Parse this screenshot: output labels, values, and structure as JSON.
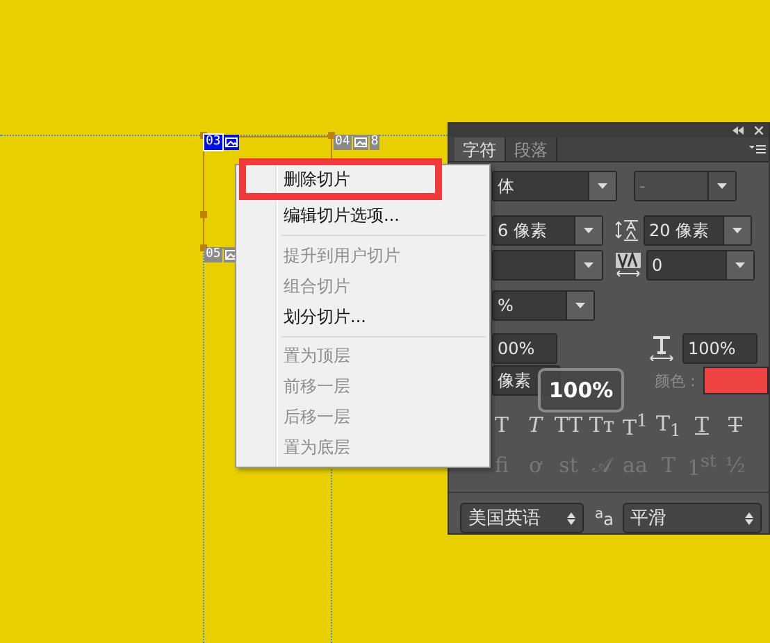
{
  "canvas": {
    "slices": [
      {
        "number": "03",
        "kind": "user",
        "selected": true
      },
      {
        "number": "04",
        "kind": "auto",
        "selected": false,
        "link": "8"
      },
      {
        "number": "05",
        "kind": "auto",
        "selected": false
      }
    ]
  },
  "character_panel": {
    "tabs": [
      {
        "label": "字符",
        "selected": true
      },
      {
        "label": "段落",
        "selected": false
      }
    ],
    "font_family": "体",
    "font_style": "-",
    "font_size": "6 像素",
    "leading": "20 像素",
    "tracking": "0",
    "scale": "%",
    "vertical_scale": "00%",
    "horizontal_scale": "100%",
    "baseline_shift": "像素",
    "color_label": "颜色：",
    "tooltip": "100%",
    "style_buttons": [
      {
        "label": "T",
        "kind": "plain"
      },
      {
        "label": "T",
        "kind": "italic"
      },
      {
        "label": "TT",
        "kind": "plain"
      },
      {
        "label": "Tт",
        "kind": "plain"
      },
      {
        "label": "T$^{1}$",
        "kind": "plain"
      },
      {
        "label": "T$_{1}$",
        "kind": "plain"
      },
      {
        "label": "T",
        "kind": "underline"
      },
      {
        "label": "T",
        "kind": "strike"
      }
    ],
    "opentype_buttons": [
      {
        "label": "fi"
      },
      {
        "label": "ơ"
      },
      {
        "label": "st"
      },
      {
        "label": "𝒜"
      },
      {
        "label": "aa"
      },
      {
        "label": "T"
      },
      {
        "label": "1$^{st}$"
      },
      {
        "label": "½"
      }
    ],
    "language": "美国英语",
    "antialias_label": "$^{a}$a",
    "antialias": "平滑"
  },
  "context_menu": {
    "items": [
      {
        "kind": "item",
        "label": "删除切片",
        "disabled": false,
        "marked": true
      },
      {
        "kind": "item",
        "label": "编辑切片选项...",
        "disabled": false,
        "marked": false
      },
      {
        "kind": "separator"
      },
      {
        "kind": "item",
        "label": "提升到用户切片",
        "disabled": true,
        "marked": false
      },
      {
        "kind": "item",
        "label": "组合切片",
        "disabled": true,
        "marked": false
      },
      {
        "kind": "item",
        "label": "划分切片...",
        "disabled": false,
        "marked": false
      },
      {
        "kind": "separator"
      },
      {
        "kind": "item",
        "label": "置为顶层",
        "disabled": true,
        "marked": false
      },
      {
        "kind": "item",
        "label": "前移一层",
        "disabled": true,
        "marked": false
      },
      {
        "kind": "item",
        "label": "后移一层",
        "disabled": true,
        "marked": false
      },
      {
        "kind": "item",
        "label": "置为底层",
        "disabled": true,
        "marked": false
      }
    ]
  }
}
